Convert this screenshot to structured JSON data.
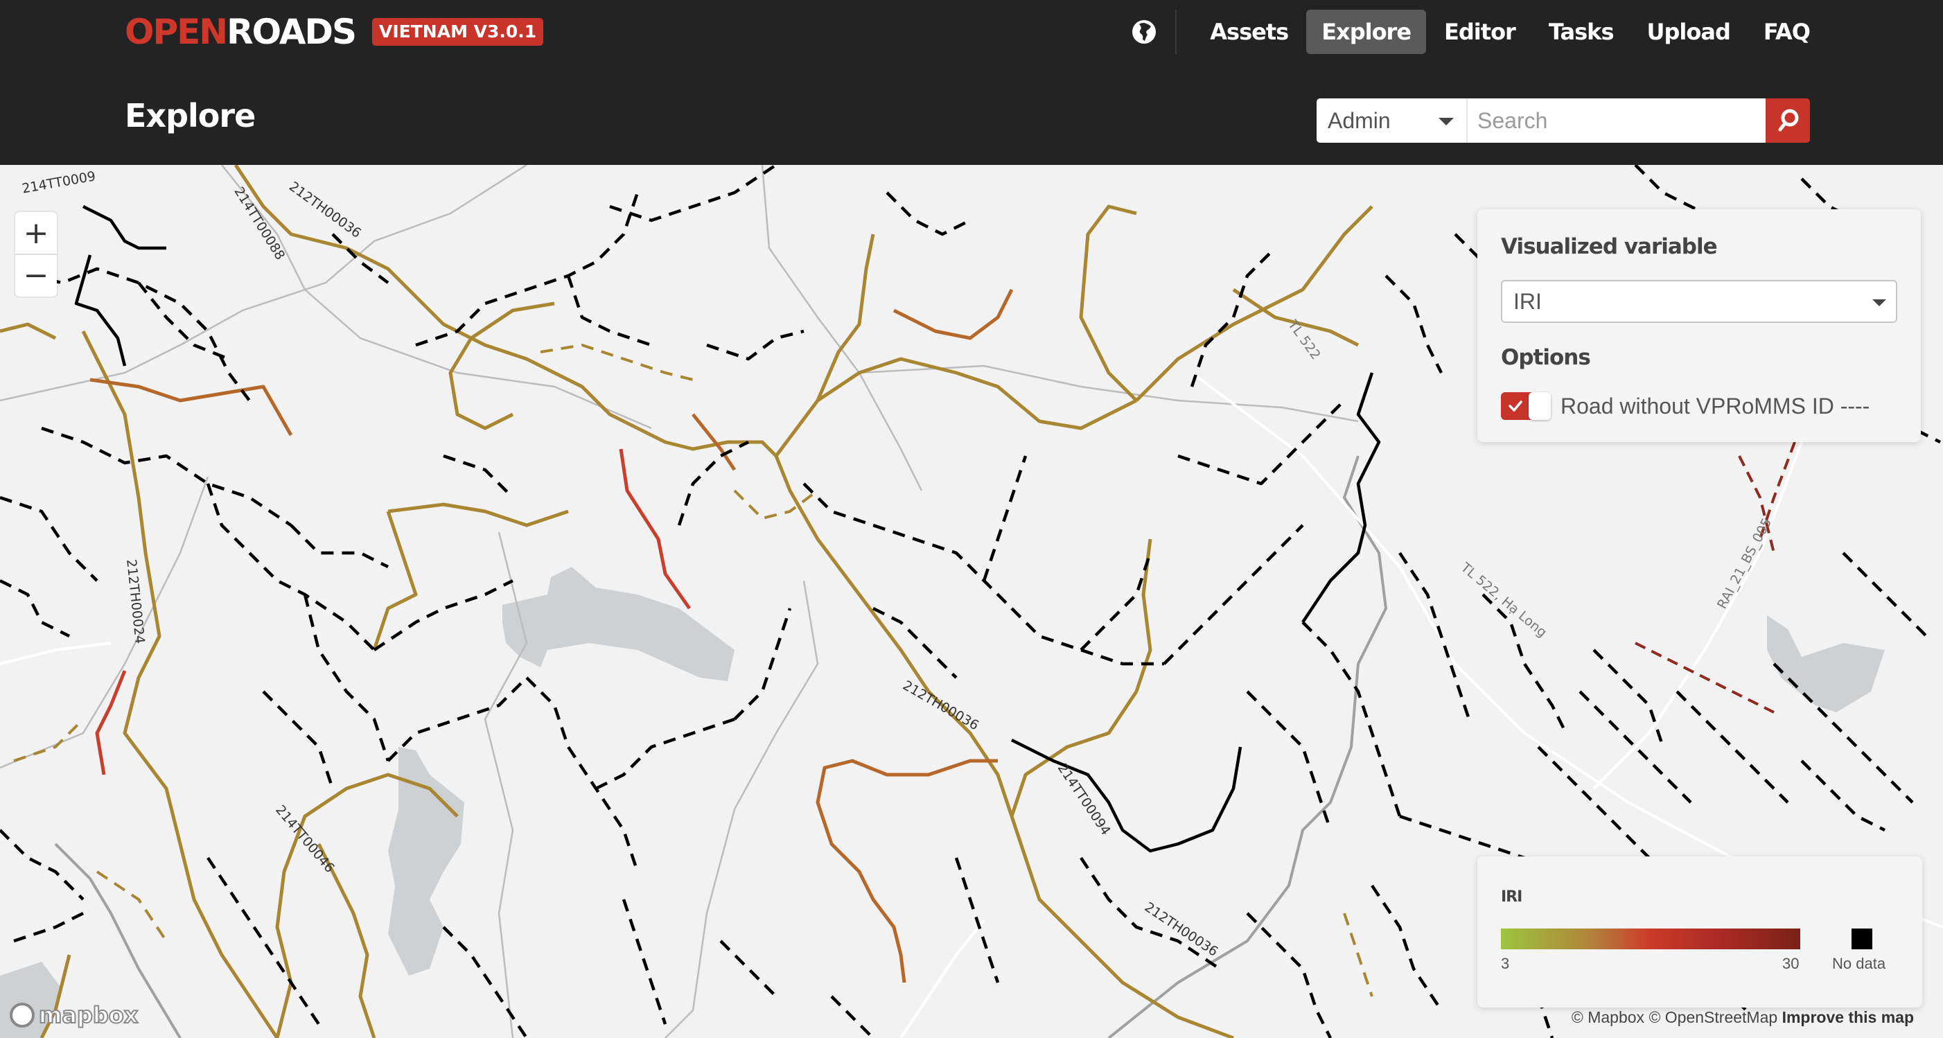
{
  "header": {
    "brand_primary": "OPEN",
    "brand_secondary": "ROADS",
    "version_badge": "VIETNAM V3.0.1",
    "language_icon": "globe-icon",
    "nav": [
      {
        "label": "Assets",
        "active": false
      },
      {
        "label": "Explore",
        "active": true
      },
      {
        "label": "Editor",
        "active": false
      },
      {
        "label": "Tasks",
        "active": false
      },
      {
        "label": "Upload",
        "active": false
      },
      {
        "label": "FAQ",
        "active": false
      }
    ],
    "page_title": "Explore",
    "search": {
      "admin_select": "Admin",
      "placeholder": "Search",
      "value": "",
      "button_icon": "search-icon"
    }
  },
  "map": {
    "zoom_in": "+",
    "zoom_out": "−",
    "labels": [
      {
        "text": "214TT0009"
      },
      {
        "text": "214TT00088"
      },
      {
        "text": "212TH00036"
      },
      {
        "text": "212TH00024"
      },
      {
        "text": "214TT00046"
      },
      {
        "text": "212TH00036"
      },
      {
        "text": "214TT00094"
      },
      {
        "text": "212TH00036"
      },
      {
        "text": "TL 522"
      },
      {
        "text": "TL 522, Hạ Long"
      },
      {
        "text": "RAI_21_BS_005"
      }
    ],
    "attribution": {
      "mapbox": "© Mapbox",
      "osm": "© OpenStreetMap",
      "improve": "Improve this map"
    },
    "logo_text": "mapbox"
  },
  "variable_panel": {
    "title": "Visualized variable",
    "selected_variable": "IRI",
    "options_title": "Options",
    "toggle_label": "Road without VPRoMMS ID ----",
    "toggle_on": true
  },
  "legend": {
    "title": "IRI",
    "min": "3",
    "max": "30",
    "no_data_label": "No data",
    "colors": {
      "low": "#9cc53d",
      "mid": "#cc3a2a",
      "high": "#7a2218",
      "no_data": "#000000"
    }
  },
  "colors": {
    "accent": "#c9342a",
    "header_bg": "#232323",
    "road_tan": "#a88632",
    "road_orange": "#b5682a",
    "road_red": "#c6402d",
    "road_none": "#000000"
  }
}
